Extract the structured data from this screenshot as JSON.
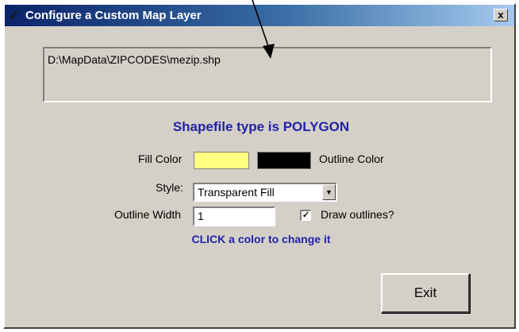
{
  "window": {
    "title": "Configure a Custom Map Layer",
    "close_glyph": "x",
    "icon_glyph": "✓"
  },
  "file_path": "D:\\MapData\\ZIPCODES\\mezip.shp",
  "shapefile_type_text": "Shapefile type is POLYGON",
  "fill": {
    "label": "Fill Color",
    "color": "#ffff80"
  },
  "outline": {
    "label": "Outline Color",
    "color": "#000000"
  },
  "style": {
    "label": "Style:",
    "value": "Transparent Fill",
    "dropdown_glyph": "▼"
  },
  "outline_width": {
    "label": "Outline Width",
    "value": "1"
  },
  "draw_outlines": {
    "label": "Draw outlines?",
    "checked": true,
    "check_glyph": "✓"
  },
  "hint": "CLICK a color to change it",
  "exit_button": "Exit",
  "colors": {
    "title_gradient_start": "#0a246a",
    "title_gradient_end": "#a6caf0",
    "dialog_face": "#d4d0c8",
    "accent_text": "#2222aa"
  }
}
